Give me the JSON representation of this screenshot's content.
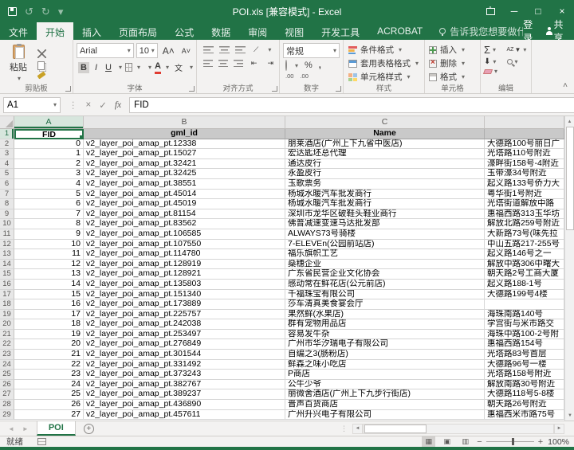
{
  "colors": {
    "accent": "#217346",
    "title_bar": "#217346",
    "ribbon_bg": "#f3f2f1",
    "header_fill": "#c9c9c9",
    "grid_line": "#d6d6d6"
  },
  "title_bar": {
    "title": "POI.xls  [兼容模式] - Excel"
  },
  "ribbon_tabs": {
    "file": "文件",
    "tabs": [
      "开始",
      "插入",
      "页面布局",
      "公式",
      "数据",
      "审阅",
      "视图",
      "开发工具",
      "ACROBAT"
    ],
    "active": "开始",
    "tell_me": "告诉我您想要做什么...",
    "sign_in": "登录",
    "share": "共享"
  },
  "ribbon": {
    "clipboard": {
      "label": "剪贴板",
      "paste": "粘贴"
    },
    "font": {
      "label": "字体",
      "name": "Arial",
      "size": "10",
      "bold": "B",
      "italic": "I",
      "underline": "U",
      "phonetic": "文"
    },
    "alignment": {
      "label": "对齐方式"
    },
    "number": {
      "label": "数字",
      "format": "常规",
      "percent": "%",
      "comma": ",",
      "dec_inc": ".00",
      "dec_dec": ".00"
    },
    "styles": {
      "label": "样式",
      "conditional": "条件格式",
      "format_table": "套用表格格式",
      "cell_styles": "单元格样式"
    },
    "cells": {
      "label": "单元格",
      "insert": "插入",
      "delete": "删除",
      "format": "格式"
    },
    "editing": {
      "label": "编辑",
      "autosum": "Σ",
      "sort": "AZ"
    }
  },
  "formula_bar": {
    "name_box": "A1",
    "fx": "fx",
    "value": "FID"
  },
  "grid": {
    "columns": [
      "A",
      "B",
      "C",
      ""
    ],
    "header_row": [
      "FID",
      "gml_id",
      "Name",
      ""
    ],
    "first_row": 1,
    "last_row": 29,
    "data_rows": [
      [
        0,
        "v2_layer_poi_amap_pt.12338",
        "朋莱酒店(广州上下九省中医店)",
        "大德路100号丽日广"
      ],
      [
        1,
        "v2_layer_poi_amap_pt.15027",
        "宏达匙坯总代理",
        "光塔路110号附近"
      ],
      [
        2,
        "v2_layer_poi_amap_pt.32421",
        "通达皮行",
        "濠畔街158号-4附近"
      ],
      [
        3,
        "v2_layer_poi_amap_pt.32425",
        "永盈皮行",
        "玉带濠34号附近"
      ],
      [
        4,
        "v2_layer_poi_amap_pt.38551",
        "玉歌票务",
        "起义路133号侨力大"
      ],
      [
        5,
        "v2_layer_poi_amap_pt.45014",
        "杨城水暖汽车批发商行",
        "粤华街1号附近"
      ],
      [
        6,
        "v2_layer_poi_amap_pt.45019",
        "杨城水暖汽车批发商行",
        "光塔街道解放中路"
      ],
      [
        7,
        "v2_layer_poi_amap_pt.81154",
        "深圳市龙华区破鞋头鞋业商行",
        "惠福西路313玉华坊"
      ],
      [
        8,
        "v2_layer_poi_amap_pt.83562",
        "佛普减速变速马达批发部",
        "解放北路259号附近"
      ],
      [
        9,
        "v2_layer_poi_amap_pt.106585",
        "ALWAYS73号骑楼",
        "大新路73号(味先拉"
      ],
      [
        10,
        "v2_layer_poi_amap_pt.107550",
        "7-ELEVEn(公园前站店)",
        "中山五路217-255号"
      ],
      [
        11,
        "v2_layer_poi_amap_pt.114780",
        "福乐旗帜工艺",
        "起义路146号之一"
      ],
      [
        12,
        "v2_layer_poi_amap_pt.128919",
        "燊穗企业",
        "解放中路306中曙大"
      ],
      [
        13,
        "v2_layer_poi_amap_pt.128921",
        "广东省民营企业文化协会",
        "朝天路2号工商大厦"
      ],
      [
        14,
        "v2_layer_poi_amap_pt.135803",
        "感动常在鲜花店(公元前店)",
        "起义路188-1号"
      ],
      [
        15,
        "v2_layer_poi_amap_pt.151340",
        "千福珠宝有限公司",
        "大德路199号4楼"
      ],
      [
        16,
        "v2_layer_poi_amap_pt.173889",
        "莎车清真美食宴会厅",
        ""
      ],
      [
        17,
        "v2_layer_poi_amap_pt.225757",
        "果然鲜(水果店)",
        "海珠南路140号"
      ],
      [
        18,
        "v2_layer_poi_amap_pt.242038",
        "群有宠物用品店",
        "学宫街与米市路交"
      ],
      [
        19,
        "v2_layer_poi_amap_pt.253497",
        "容易发牛杂",
        "海珠中路100-2号附"
      ],
      [
        20,
        "v2_layer_poi_amap_pt.276849",
        "广州市华汐瑞电子有限公司",
        "惠福西路154号"
      ],
      [
        21,
        "v2_layer_poi_amap_pt.301544",
        "自编之3(肠粉店)",
        "光塔路83号首层"
      ],
      [
        22,
        "v2_layer_poi_amap_pt.331492",
        "鲜森之味小吃店",
        "大德路96号一楼"
      ],
      [
        23,
        "v2_layer_poi_amap_pt.373243",
        "P商店",
        "光塔路158号附近"
      ],
      [
        24,
        "v2_layer_poi_amap_pt.382767",
        "公牛少爷",
        "解放南路30号附近"
      ],
      [
        25,
        "v2_layer_poi_amap_pt.389237",
        "丽微舍酒店(广州上下九步行街店)",
        "大德路118号5-8楼"
      ],
      [
        26,
        "v2_layer_poi_amap_pt.436890",
        "晋声百货商店",
        "朝天路26号附近"
      ],
      [
        27,
        "v2_layer_poi_amap_pt.457611",
        "广州升兴电子有限公司",
        "惠福西米市路75号"
      ]
    ]
  },
  "sheet_bar": {
    "active_tab": "POI"
  },
  "status_bar": {
    "mode": "就绪",
    "zoom": "100%"
  }
}
